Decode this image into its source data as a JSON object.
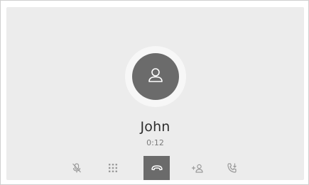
{
  "call": {
    "caller_name": "John",
    "duration": "0:12"
  },
  "icons": {
    "avatar": "person-icon",
    "mute": "microphone-muted-icon",
    "keypad": "keypad-icon",
    "end_call": "hang-up-icon",
    "add_call": "add-person-icon",
    "transfer": "handset-transfer-icon"
  },
  "colors": {
    "screen_background": "#ececec",
    "avatar_background": "#6b6b6b",
    "end_call_background": "#6b6b6b",
    "icon_gray": "#9a9a9a"
  }
}
